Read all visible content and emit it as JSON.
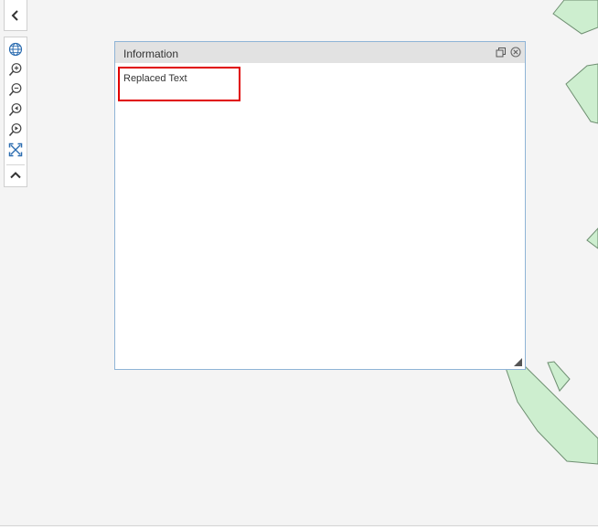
{
  "colors": {
    "map_background": "#f4f4f4",
    "feature_fill": "#cdeecf",
    "feature_stroke": "#6f8f72",
    "panel_border": "#8fb4d6",
    "panel_header": "#e2e2e2",
    "highlight": "#e00000",
    "icon_blue": "#2b6cb0"
  },
  "navigation": {
    "collapse_icon": "chevron-left-icon",
    "tools": [
      {
        "name": "globe-icon"
      },
      {
        "name": "zoom-in-icon"
      },
      {
        "name": "zoom-out-icon"
      },
      {
        "name": "zoom-previous-icon"
      },
      {
        "name": "zoom-next-icon"
      },
      {
        "name": "full-extent-icon"
      },
      {
        "name": "chevron-up-icon"
      }
    ]
  },
  "panel": {
    "title": "Information",
    "content": "Replaced Text",
    "controls": [
      "restore-icon",
      "close-icon"
    ]
  }
}
